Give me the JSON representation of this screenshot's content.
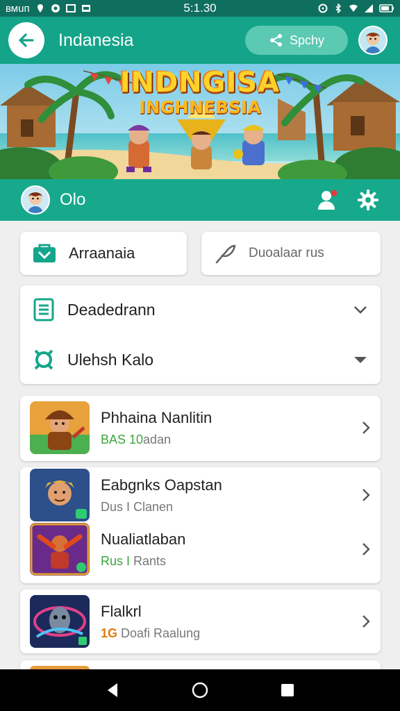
{
  "status_bar": {
    "carrier": "вмuп",
    "time": "5:1.30",
    "icons": [
      "location-icon",
      "circle-badge-icon",
      "image-icon",
      "cast-icon",
      "alarm-icon",
      "bluetooth-icon",
      "wifi-icon",
      "signal-icon",
      "battery-icon"
    ]
  },
  "header": {
    "title": "Indanesia",
    "share_label": "Spchy",
    "back_icon": "arrow-left-icon",
    "share_icon": "share-icon"
  },
  "banner": {
    "title": "INDNGISA",
    "subtitle": "INGHNEBSIA"
  },
  "profile": {
    "name": "Olo",
    "icons": [
      "add-friend-icon",
      "gear-icon"
    ]
  },
  "quick_actions": [
    {
      "label": "Arraanaia",
      "icon": "folder-icon"
    },
    {
      "label": "Duoalaar rus",
      "icon": "feather-icon"
    }
  ],
  "dropdowns": [
    {
      "label": "Deadedrann",
      "icon": "document-icon"
    },
    {
      "label": "Ulehsh Kalo",
      "icon": "badge-icon"
    }
  ],
  "games": [
    {
      "title": "Phhaina Nanlitin",
      "sub_accent": "BAS 10",
      "sub_rest": "adan"
    },
    {
      "title": "Eabgnks Oapstan",
      "sub_accent": "",
      "sub_rest": "Dus I Clanen"
    },
    {
      "title": "Nualiatlaban",
      "sub_accent": "Rus I",
      "sub_rest": " Rants"
    },
    {
      "title": "Flalkrl",
      "sub_accent": "1G",
      "sub_rest": " Doafi Raalung"
    }
  ],
  "colors": {
    "primary": "#14a489",
    "primary_dark": "#0f6f5f",
    "accent_green": "#3aa53a",
    "accent_orange": "#e07d12"
  }
}
